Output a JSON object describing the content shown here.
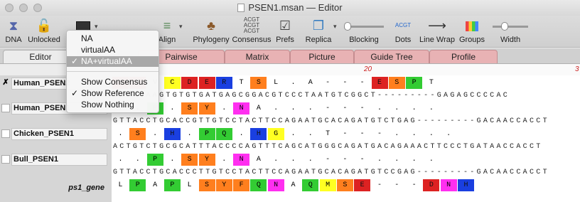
{
  "window": {
    "title": "PSEN1.msan — Editor"
  },
  "toolbar": {
    "items": [
      {
        "label": "DNA",
        "icon": "dna-icon"
      },
      {
        "label": "Unlocked",
        "icon": "unlocked-icon"
      },
      {
        "label": "",
        "icon": "display-mode-icon"
      },
      {
        "label": "Align",
        "icon": "align-icon"
      },
      {
        "label": "Phylogeny",
        "icon": "phylogeny-icon"
      },
      {
        "label": "Consensus",
        "icon": "consensus-icon"
      },
      {
        "label": "Prefs",
        "icon": "prefs-icon"
      },
      {
        "label": "Replica",
        "icon": "replica-icon"
      },
      {
        "label": "Blocking",
        "icon": "blocking-slider-icon"
      },
      {
        "label": "Dots",
        "icon": "dots-icon"
      },
      {
        "label": "Line Wrap",
        "icon": "line-wrap-icon"
      },
      {
        "label": "Groups",
        "icon": "groups-icon"
      },
      {
        "label": "Width",
        "icon": "width-slider-icon"
      }
    ],
    "consensus_glyph": "ACGT",
    "dots_glyph": "ACGT"
  },
  "tabs": [
    "Editor",
    "Pairwise",
    "Matrix",
    "Picture",
    "Guide Tree",
    "Profile"
  ],
  "active_tab": "Editor",
  "ruler": {
    "mark_20": "20",
    "mark_3": "3"
  },
  "menu": {
    "items": [
      {
        "label": "NA",
        "checked": false,
        "selected": false
      },
      {
        "label": "virtualAA",
        "checked": false,
        "selected": false
      },
      {
        "label": "NA+virtualAA",
        "checked": true,
        "selected": true
      }
    ],
    "items2": [
      {
        "label": "Show Consensus",
        "checked": false
      },
      {
        "label": "Show Reference",
        "checked": true
      },
      {
        "label": "Show Nothing",
        "checked": false
      }
    ]
  },
  "sequences": [
    {
      "name": "Human_PSEN2",
      "checkbox": "✗"
    },
    {
      "name": "Human_PSEN1",
      "checkbox": ""
    },
    {
      "name": "Chicken_PSEN1",
      "checkbox": ""
    },
    {
      "name": "Bull_PSEN1",
      "checkbox": ""
    },
    {
      "name": "ps1_gene",
      "checkbox": ""
    }
  ],
  "rows": {
    "r0_aa": [
      "E",
      "E",
      "V",
      "C",
      "D",
      "E",
      "R",
      "T",
      "S",
      "L",
      ".",
      "A",
      "-",
      "-",
      "-",
      "E",
      "S",
      "P",
      "T"
    ],
    "r1_nt": "GGAAGAAGTGTGTGATGAGCGGACGTCCCTAATGTCGGCT---------GAGAGCCCCAC",
    "r2_aa": [
      ".",
      ".",
      "P",
      ".",
      "S",
      "Y",
      ".",
      "N",
      "A",
      ".",
      ".",
      ".",
      "-",
      "-",
      "-",
      ".",
      ".",
      ".",
      "."
    ],
    "r3_nt": "GTTACCTGCACCGTTGTCCTACTTCCAGAATGCACAGATGTCTGAG---------GACAACCACCT",
    "r4_aa": [
      ".",
      "S",
      ".",
      "H",
      ".",
      "P",
      "Q",
      ".",
      "H",
      "G",
      ".",
      ".",
      "T",
      "-",
      "-",
      "-",
      ".",
      ".",
      ".",
      "."
    ],
    "r5_nt": "ACTGTCTGCGCATTTACCCCAGTTTCAGCATGGGCAGATGACAGAAACTTCCCTGATAACCACCT",
    "r6_aa": [
      ".",
      ".",
      "P",
      ".",
      "S",
      "Y",
      ".",
      "N",
      "A",
      ".",
      ".",
      ".",
      "-",
      "-",
      "-",
      ".",
      ".",
      ".",
      "."
    ],
    "r7_nt": "GTTACCTGCACCCTTGTCCTACTTCCAGAATGCACAGATGTCCGAG---------GACAACCACCT",
    "r8_aa": [
      "L",
      "P",
      "A",
      "P",
      "L",
      "S",
      "Y",
      "F",
      "Q",
      "N",
      "A",
      "Q",
      "M",
      "S",
      "E",
      "-",
      "-",
      "-",
      "D",
      "N",
      "H"
    ]
  },
  "colors": {
    "E": "#dd2222",
    "V": "#ffffff",
    "C": "#ffff22",
    "D": "#dd2222",
    "R": "#1a3fe0",
    "T": "#ffffff",
    "S": "#ff7f1e",
    "L": "#ffffff",
    "A": "#ffffff",
    "P": "#33cc33",
    "Y": "#ff7f1e",
    "N": "#ff2ff0",
    "Q": "#33cc33",
    "H": "#1a3fe0",
    "G": "#ffff22",
    "F": "#ff7f1e",
    "M": "#ffff22",
    "dot": "#ffffff",
    "gap": "#ffffff"
  }
}
